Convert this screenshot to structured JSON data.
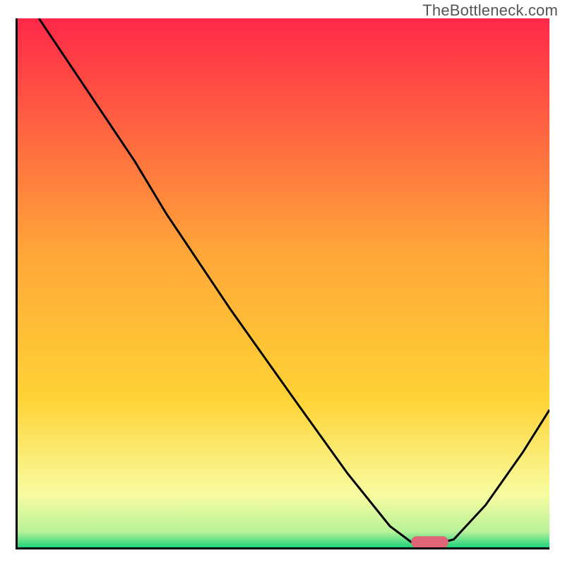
{
  "watermark": "TheBottleneck.com",
  "chart_data": {
    "type": "line",
    "title": "",
    "xlabel": "",
    "ylabel": "",
    "xlim": [
      0,
      100
    ],
    "ylim": [
      0,
      100
    ],
    "axes_shown": false,
    "gradient": {
      "top_color": "#ff2848",
      "mid_color": "#ffd335",
      "low_color": "#f8fca0",
      "bottom_color": "#1fd37a"
    },
    "series": [
      {
        "name": "bottleneck-curve",
        "color": "#000000",
        "x": [
          4,
          12,
          22,
          28,
          40,
          52,
          62,
          70,
          74,
          78,
          82,
          88,
          95,
          100
        ],
        "y": [
          100,
          88,
          73,
          63,
          45,
          28,
          14,
          4,
          1,
          0.5,
          1.5,
          8,
          18,
          26
        ]
      }
    ],
    "marker": {
      "name": "optimal-zone",
      "shape": "rounded-bar",
      "color": "#e06677",
      "x_center": 77.5,
      "y_center": 1,
      "width_frac": 7,
      "height_frac": 2.2
    }
  }
}
